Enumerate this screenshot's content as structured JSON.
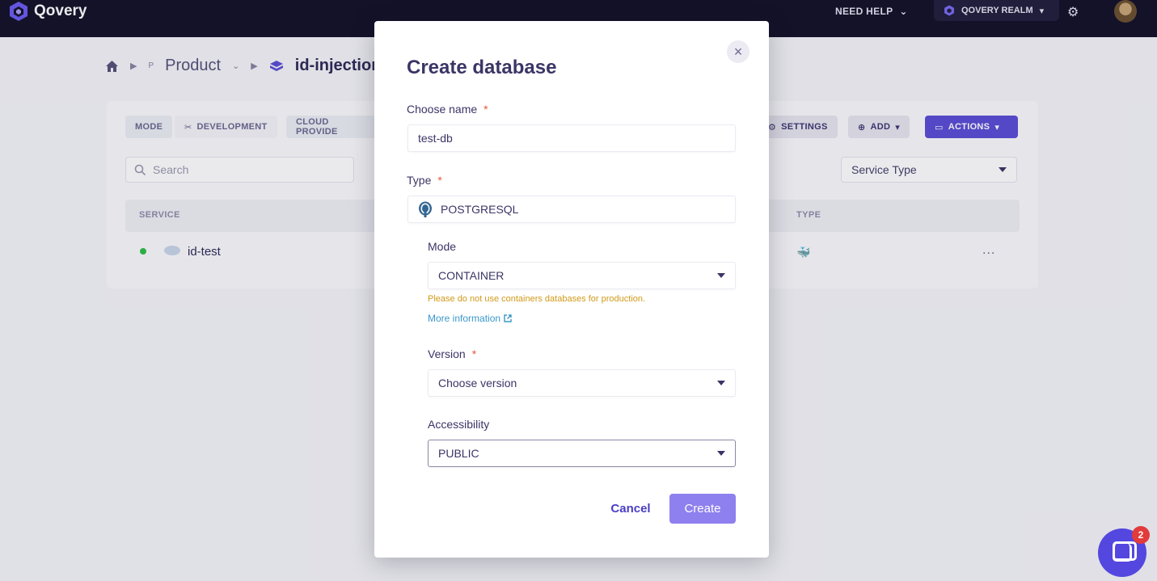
{
  "topbar": {
    "brand": "Qovery",
    "need_help": "NEED HELP",
    "realm": "QOVERY REALM"
  },
  "breadcrumb": {
    "project_initial": "P",
    "project": "Product",
    "environment": "id-injection"
  },
  "toolbar": {
    "mode_label": "MODE",
    "mode_value": "DEVELOPMENT",
    "cloud_provider_label": "CLOUD PROVIDE",
    "settings": "SETTINGS",
    "add": "ADD",
    "actions": "ACTIONS"
  },
  "filters": {
    "search_placeholder": "Search",
    "service_type": "Service Type"
  },
  "table": {
    "columns": [
      "SERVICE",
      "TYPE"
    ],
    "rows": [
      {
        "name": "id-test",
        "status_color": "#2fbd4a"
      }
    ],
    "more_label": "..."
  },
  "modal": {
    "title": "Create database",
    "name_label": "Choose name",
    "name_value": "test-db",
    "type_label": "Type",
    "type_value": "POSTGRESQL",
    "mode_label": "Mode",
    "mode_value": "CONTAINER",
    "mode_warning": "Please do not use containers databases for production.",
    "more_info": "More information",
    "version_label": "Version",
    "version_placeholder": "Choose version",
    "accessibility_label": "Accessibility",
    "accessibility_value": "PUBLIC",
    "required_mark": "*",
    "cancel": "Cancel",
    "create": "Create",
    "close_symbol": "×"
  },
  "chat": {
    "badge": "2"
  },
  "colors": {
    "primary": "#5b4dd6",
    "warning": "#d19a1a",
    "link": "#3a98c9",
    "required": "#e8553f"
  }
}
